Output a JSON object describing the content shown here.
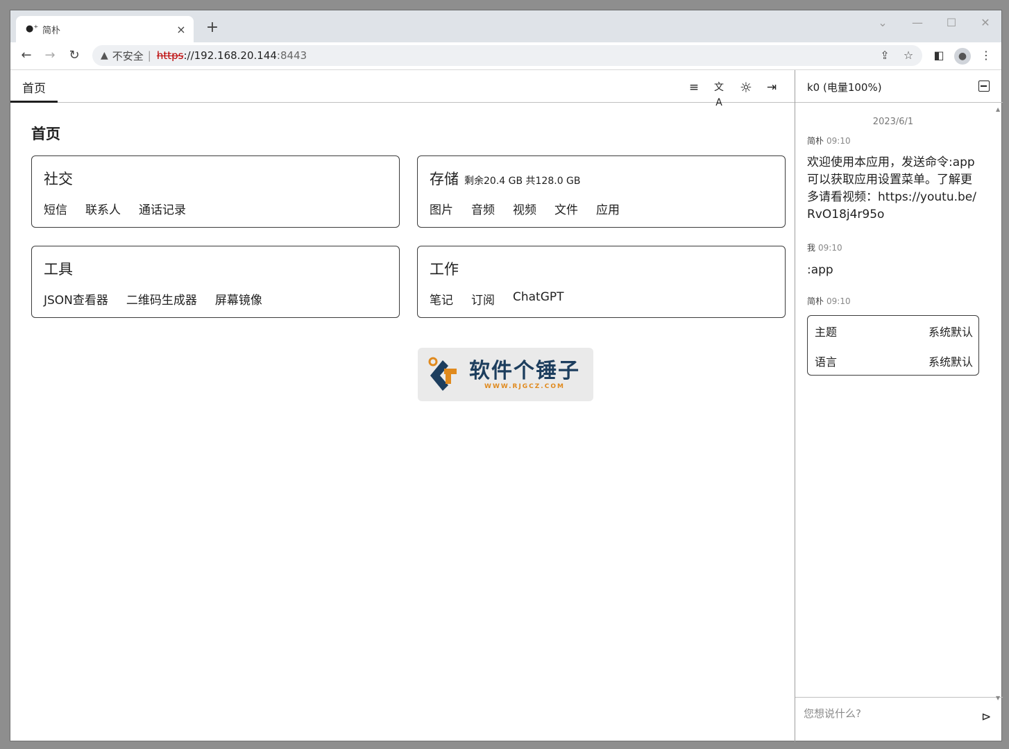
{
  "browser": {
    "tab_title": "简朴",
    "tab_close": "×",
    "new_tab": "+",
    "window_controls": {
      "chevron": "⌄",
      "minimize": "—",
      "maximize": "☐",
      "close": "✕"
    },
    "nav": {
      "back": "←",
      "forward": "→",
      "reload": "↻"
    },
    "address": {
      "warning_icon": "▲",
      "insecure": "不安全",
      "separator": "|",
      "scheme": "https",
      "host": "://192.168.20.144",
      "port": ":8443"
    },
    "icons": {
      "share": "⇪",
      "bookmark": "☆",
      "sidepanel": "◧",
      "profile": "●",
      "menu": "⋮"
    }
  },
  "app": {
    "tab_home": "首页",
    "top_icons": {
      "playlist": "≡",
      "translate": "文A",
      "theme": "☼",
      "logout": "⇥"
    },
    "page_title": "首页",
    "cards": [
      {
        "title": "社交",
        "subtitle": "",
        "links": [
          "短信",
          "联系人",
          "通话记录"
        ]
      },
      {
        "title": "存储",
        "subtitle": "剩余20.4 GB 共128.0 GB",
        "links": [
          "图片",
          "音频",
          "视频",
          "文件",
          "应用"
        ]
      },
      {
        "title": "工具",
        "subtitle": "",
        "links": [
          "JSON查看器",
          "二维码生成器",
          "屏幕镜像"
        ]
      },
      {
        "title": "工作",
        "subtitle": "",
        "links": [
          "笔记",
          "订阅",
          "ChatGPT"
        ]
      }
    ],
    "watermark": {
      "name": "软件个锤子",
      "url": "WWW.RJGCZ.COM"
    }
  },
  "chat": {
    "device": "k0 (电量100%)",
    "date": "2023/6/1",
    "messages": [
      {
        "sender": "简朴",
        "time": "09:10",
        "text": "欢迎使用本应用，发送命令:app可以获取应用设置菜单。了解更多请看视频：https://youtu.be/RvO18j4r95o"
      },
      {
        "sender": "我",
        "time": "09:10",
        "text": ":app"
      },
      {
        "sender": "简朴",
        "time": "09:10",
        "text": ""
      }
    ],
    "settings": [
      {
        "label": "主题",
        "value": "系统默认"
      },
      {
        "label": "语言",
        "value": "系统默认"
      }
    ],
    "input_placeholder": "您想说什么?",
    "send_icon": "⊳",
    "scroll_up": "▲",
    "scroll_down": "▼"
  }
}
